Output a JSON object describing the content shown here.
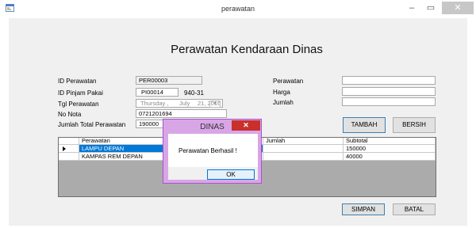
{
  "window": {
    "title": "perawatan",
    "minimize_glyph": "–",
    "maximize_glyph": "▭",
    "close_glyph": "✕",
    "icon": "form-icon"
  },
  "heading": "Perawatan Kendaraan Dinas",
  "form": {
    "id_perawatan_label": "ID Perawatan",
    "id_perawatan_value": "PER00003",
    "id_pinjam_label": "ID Pinjam Pakai",
    "id_pinjam_value": "PI00014",
    "id_pinjam_extra": "940-31",
    "tgl_label": "Tgl Perawatan",
    "tgl_day": "Thursday ,",
    "tgl_month": "July",
    "tgl_date": "21, 2016",
    "no_nota_label": "No Nota",
    "no_nota_value": "0721201694",
    "jumlah_total_label": "Jumlah Total Perawatan",
    "jumlah_total_value": "190000",
    "perawatan_label": "Perawatan",
    "perawatan_value": "",
    "harga_label": "Harga",
    "harga_value": "",
    "jumlah_label": "Jumlah",
    "jumlah_value": ""
  },
  "buttons": {
    "tambah": "TAMBAH",
    "bersih": "BERSIH",
    "simpan": "SIMPAN",
    "batal": "BATAL"
  },
  "grid": {
    "columns": [
      "Perawatan",
      "Jumlah",
      "Subtotal"
    ],
    "rows": [
      {
        "perawatan": "LAMPU DEPAN",
        "jumlah": "",
        "subtotal": "150000",
        "selected": true
      },
      {
        "perawatan": "KAMPAS REM DEPAN",
        "jumlah": "",
        "subtotal": "40000",
        "selected": false
      }
    ]
  },
  "dialog": {
    "title": "DINAS",
    "message": "Perawatan Berhasil !",
    "ok": "OK",
    "close_glyph": "✕"
  },
  "colors": {
    "dialog_frame": "#d8a6e6",
    "selection": "#0078d7",
    "close_red": "#c9302c"
  }
}
